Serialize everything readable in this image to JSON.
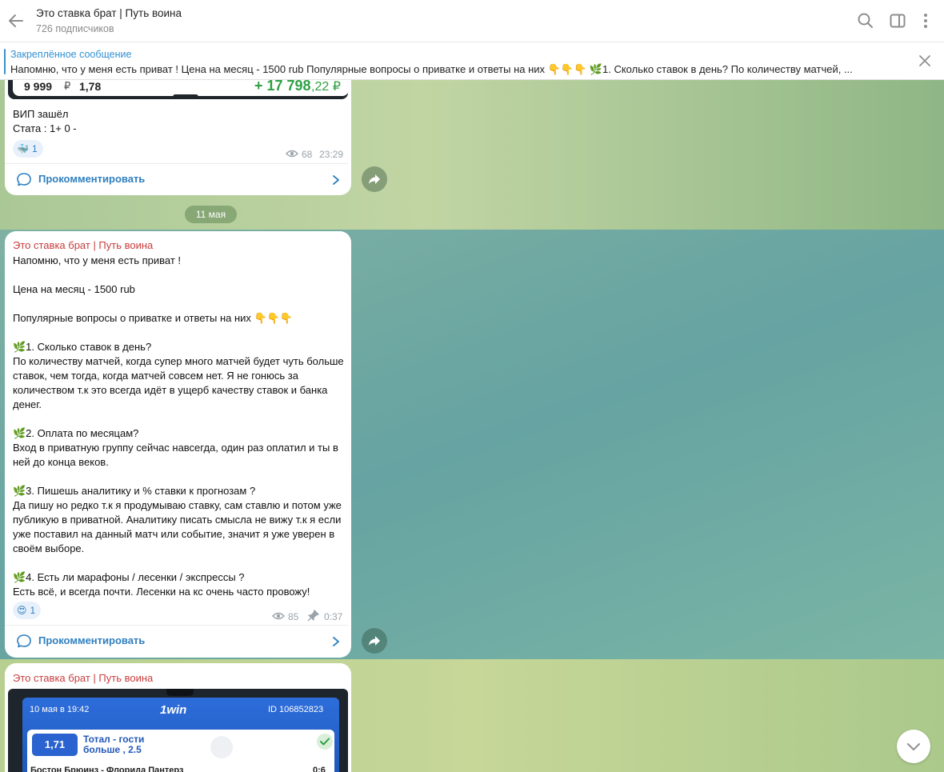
{
  "header": {
    "title": "Это ставка брат | Путь воина",
    "subscribers": "726 подписчиков"
  },
  "pinned": {
    "title": "Закреплённое сообщение",
    "text": "Напомню, что у меня есть приват !  Цена на месяц - 1500 rub  Популярные вопросы о приватке и ответы на них 👇👇👇 🌿1. Сколько ставок в день?  По количеству матчей, ..."
  },
  "messages": [
    {
      "screenshot": {
        "amount": "9 999",
        "currency": "₽",
        "coef": "1,78",
        "win": "+ 17 798",
        "win_dec": ",22 ₽"
      },
      "text": "ВИП зашёл\nСтата : 1+ 0 -",
      "reaction": {
        "emoji": "🐳",
        "count": "1"
      },
      "views": "68",
      "time": "23:29",
      "comment_label": "Прокомментировать"
    },
    {
      "sender": "Это ставка брат | Путь воина",
      "text": "Напомню, что у меня есть приват !\n\nЦена на месяц - 1500 rub\n\nПопулярные вопросы о приватке и ответы на них 👇👇👇\n\n🌿1. Сколько ставок в день?\nПо количеству матчей, когда супер много матчей будет чуть больше ставок, чем тогда, когда матчей совсем нет. Я не гонюсь за количеством т.к это всегда идёт в ущерб качеству ставок и банка денег.\n\n🌿2. Оплата по месяцам?\nВход в приватную группу сейчас навсегда, один раз оплатил и ты в ней до конца веков.\n\n🌿3. Пишешь аналитику и % ставки к прогнозам ?\nДа пишу но редко т.к я продумываю ставку, сам ставлю и потом уже публикую в приватной. Аналитику писать смысла не вижу т.к я если уже поставил на данный матч или событие, значит я уже уверен в своём выборе.\n\n🌿4. Есть ли марафоны / лесенки / экспрессы ?\nЕсть всё, и всегда почти. Лесенки на кс очень часто провожу!",
      "reaction": {
        "emoji": "😍",
        "count": "1"
      },
      "views": "85",
      "time": "0:37",
      "comment_label": "Прокомментировать"
    },
    {
      "sender": "Это ставка брат | Путь воина",
      "bet": {
        "date": "10 мая в 19:42",
        "brand": "1win",
        "id": "ID 106852823",
        "coef": "1,71",
        "market_line1": "Тотал - гости",
        "market_line2": "больше , 2.5",
        "teams": "Бостон Брюинз - Флорида Пантерз",
        "score": "0:6"
      }
    }
  ],
  "date_separator": "11 мая",
  "colors": {
    "accent": "#3390d1",
    "sender": "#c83c3c",
    "win_green": "#2ea043"
  }
}
